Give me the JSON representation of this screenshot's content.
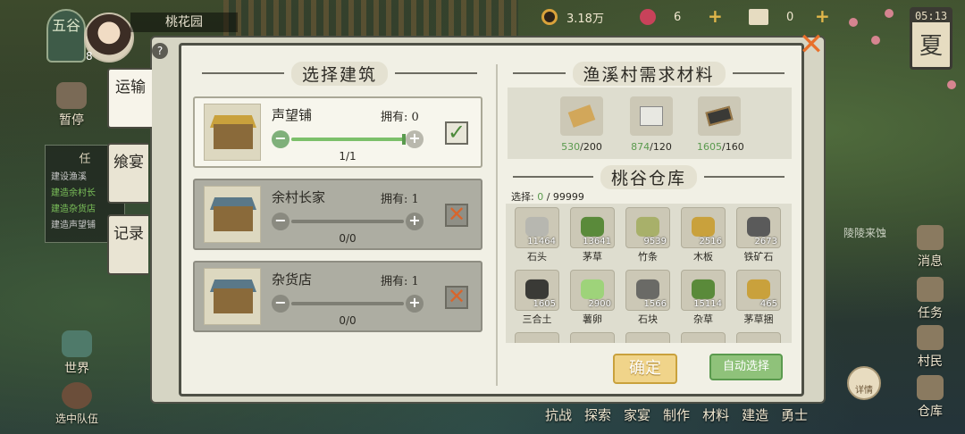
{
  "top_bar": {
    "season_badge": "五谷",
    "avatar_level": "8",
    "village_name": "桃花园",
    "coins": "3.18万",
    "flowers": "6",
    "tickets": "0",
    "clock_time": "05:13",
    "clock_season": "夏"
  },
  "left_menu": {
    "pause_label": "暂停",
    "world_label": "世界",
    "squad_label": "选中队伍",
    "quest_title": "任",
    "quest_lines": [
      "建设渔溪",
      "建造余村长",
      "建造杂货店",
      "建造声望铺"
    ]
  },
  "side_tabs": [
    {
      "label": "运输"
    },
    {
      "label": "飨宴"
    },
    {
      "label": "记录"
    }
  ],
  "right_menu": {
    "map_label": "陵陵来蚀",
    "items": [
      "消息",
      "任务",
      "村民",
      "仓库"
    ],
    "detail_label": "详情"
  },
  "bottom_nav": [
    "抗战",
    "探索",
    "家宴",
    "制作",
    "材料",
    "建造",
    "勇士"
  ],
  "dialog": {
    "help": "?",
    "close": "✕",
    "left_title": "选择建筑",
    "buildings": [
      {
        "name": "声望铺",
        "own": "拥有: 0",
        "count": "1/1",
        "selected": true,
        "fill": 1.0
      },
      {
        "name": "余村长家",
        "own": "拥有: 1",
        "count": "0/0",
        "selected": false,
        "fill": 0.0
      },
      {
        "name": "杂货店",
        "own": "拥有: 1",
        "count": "0/0",
        "selected": false,
        "fill": 0.0
      }
    ],
    "needs_title": "渔溪村需求材料",
    "needs": [
      {
        "icon": "wood-plank-icon",
        "have": "530",
        "need": "/200"
      },
      {
        "icon": "white-stone-icon",
        "have": "874",
        "need": "/120"
      },
      {
        "icon": "clay-icon",
        "have": "1605",
        "need": "/160"
      }
    ],
    "warehouse_title": "桃谷仓库",
    "select_label": "选择: ",
    "select_current": "0",
    "select_max": " / 99999",
    "warehouse": [
      {
        "name": "石头",
        "qty": "11464",
        "color": "#b7b7b0"
      },
      {
        "name": "茅草",
        "qty": "13641",
        "color": "#5a8a3a"
      },
      {
        "name": "竹条",
        "qty": "9539",
        "color": "#a8b06a"
      },
      {
        "name": "木板",
        "qty": "2516",
        "color": "#c9a13c"
      },
      {
        "name": "铁矿石",
        "qty": "2673",
        "color": "#5a5a5a"
      },
      {
        "name": "三合土",
        "qty": "1605",
        "color": "#3a3a36"
      },
      {
        "name": "薯卵",
        "qty": "2900",
        "color": "#9ed37a"
      },
      {
        "name": "石块",
        "qty": "1566",
        "color": "#6a6a66"
      },
      {
        "name": "杂草",
        "qty": "15114",
        "color": "#5a8a3a"
      },
      {
        "name": "茅草捆",
        "qty": "465",
        "color": "#c9a13c"
      }
    ],
    "confirm": "确定",
    "auto_select": "自动选择"
  }
}
